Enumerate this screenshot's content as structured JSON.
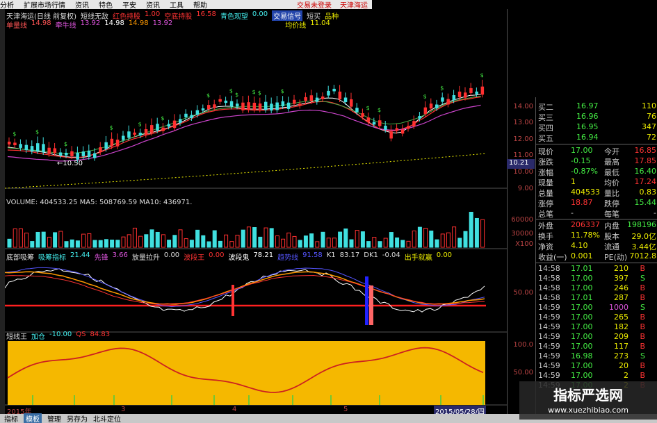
{
  "menu": {
    "items": [
      "分析",
      "扩展市场行情",
      "资讯",
      "特色",
      "平安",
      "资讯",
      "工具",
      "帮助"
    ],
    "right": [
      "交易未登录",
      "天津海运"
    ]
  },
  "chart_header": {
    "title": "天津海运(日线 前复权)",
    "indicator": "短线无敌",
    "red_label": "红色持股",
    "red_val": "1.00",
    "stop_label": "空底持股",
    "stop_val": "16.58",
    "watch_label": "青色观望",
    "watch_val": "0.00",
    "tag1": "交易信号",
    "tag2": "短买",
    "tag3": "品种"
  },
  "ma_bar": {
    "l1": "单量线",
    "v1": "14.98",
    "l2": "牵牛线",
    "v2": "13.92",
    "v3": "14.98",
    "v4": "14.98",
    "v5": "13.92",
    "avg_label": "均价线",
    "avg_val": "11.04"
  },
  "low_label": "←10.50",
  "volume_label": "VOLUME: 404533.25  MA5: 508769.59  MA10: 436971.",
  "ind1": {
    "name": "底部吸筹",
    "l1": "吸筹指标",
    "v1": "21.44",
    "l2": "先锋",
    "v2": "3.66",
    "l3": "放量拉升",
    "v3": "0.00",
    "l4": "波段王",
    "v4": "0.00",
    "l5": "波段鬼",
    "v5": "78.21",
    "l6": "趋势线",
    "v6": "91.58",
    "l7": "K1",
    "v7": "83.17",
    "l8": "DK1",
    "v8": "-0.04",
    "l9": "出手就赢",
    "v9": "0.00"
  },
  "ind2": {
    "name": "短线王",
    "l1": "加仓",
    "v1": "-10.00",
    "l2": "QS",
    "v2": "84.83"
  },
  "axis": {
    "price": [
      "14.00",
      "13.00",
      "12.00",
      "11.00",
      "10.00",
      "9.00"
    ],
    "price_tag": "10.21",
    "vol": [
      "60000",
      "30000",
      "X100"
    ],
    "ind1": [
      "50.00"
    ],
    "ind2": [
      "100.0",
      "50.00"
    ],
    "dates": [
      "2015年",
      "3",
      "4",
      "5",
      "2015/05/28/四"
    ]
  },
  "quote": {
    "bids": [
      {
        "label": "买二",
        "price": "16.97",
        "vol": "110"
      },
      {
        "label": "买三",
        "price": "16.96",
        "vol": "76"
      },
      {
        "label": "买四",
        "price": "16.95",
        "vol": "347"
      },
      {
        "label": "买五",
        "price": "16.94",
        "vol": "72"
      }
    ],
    "stats": [
      {
        "l1": "现价",
        "v1": "17.00",
        "l2": "今开",
        "v2": "16.85"
      },
      {
        "l1": "涨跌",
        "v1": "-0.15",
        "l2": "最高",
        "v2": "17.85"
      },
      {
        "l1": "涨幅",
        "v1": "-0.87%",
        "l2": "最低",
        "v2": "16.40"
      },
      {
        "l1": "现量",
        "v1": "1",
        "l2": "均价",
        "v2": "17.24"
      },
      {
        "l1": "总量",
        "v1": "404533",
        "l2": "量比",
        "v2": "0.83"
      },
      {
        "l1": "涨停",
        "v1": "18.87",
        "l2": "跌停",
        "v2": "15.44"
      },
      {
        "l1": "总笔",
        "v1": "-",
        "l2": "每笔",
        "v2": "-"
      },
      {
        "l1": "外盘",
        "v1": "206337",
        "l2": "内盘",
        "v2": "198196"
      },
      {
        "l1": "换手",
        "v1": "11.78%",
        "l2": "股本",
        "v2": "29.0亿"
      },
      {
        "l1": "净资",
        "v1": "4.10",
        "l2": "流通",
        "v2": "3.44亿"
      },
      {
        "l1": "收益(一)",
        "v1": "0.001",
        "l2": "PE(动)",
        "v2": "7012.8"
      }
    ],
    "ticks": [
      {
        "t": "14:58",
        "p": "17.01",
        "v": "210",
        "s": "B"
      },
      {
        "t": "14:58",
        "p": "17.00",
        "v": "397",
        "s": "S"
      },
      {
        "t": "14:58",
        "p": "17.00",
        "v": "246",
        "s": "B"
      },
      {
        "t": "14:58",
        "p": "17.01",
        "v": "287",
        "s": "B"
      },
      {
        "t": "14:59",
        "p": "17.00",
        "v": "1000",
        "s": "S"
      },
      {
        "t": "14:59",
        "p": "17.00",
        "v": "265",
        "s": "B"
      },
      {
        "t": "14:59",
        "p": "17.00",
        "v": "182",
        "s": "B"
      },
      {
        "t": "14:59",
        "p": "17.00",
        "v": "209",
        "s": "B"
      },
      {
        "t": "14:59",
        "p": "17.00",
        "v": "117",
        "s": "B"
      },
      {
        "t": "14:59",
        "p": "16.98",
        "v": "273",
        "s": "S"
      },
      {
        "t": "14:59",
        "p": "17.00",
        "v": "20",
        "s": "B"
      },
      {
        "t": "14:59",
        "p": "17.00",
        "v": "2",
        "s": "B"
      },
      {
        "t": "14:59",
        "p": "17.00",
        "v": "2",
        "s": "B"
      }
    ]
  },
  "tabs": [
    "指标",
    "模板",
    "管理",
    "另存为",
    "北斗定位"
  ],
  "watermark": {
    "title": "指标严选网",
    "url": "www.xuezhibiao.com"
  },
  "colors": {
    "up": "#ff3030",
    "down": "#40e0e0",
    "ma1": "#ffffff",
    "ma2": "#ff9900",
    "ma3": "#cc44cc",
    "yellow_fill": "#f5b800"
  }
}
